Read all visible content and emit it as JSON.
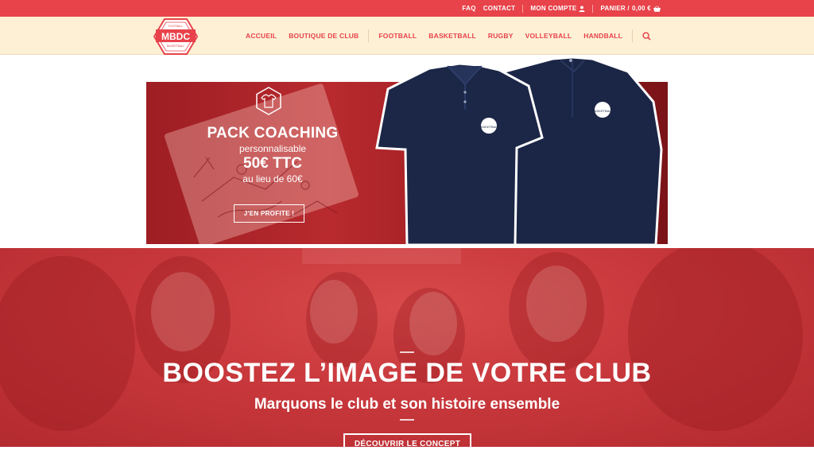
{
  "topbar": {
    "faq": "FAQ",
    "contact": "CONTACT",
    "account": "MON COMPTE",
    "cart": "PANIER /",
    "cart_total": "0,00 €"
  },
  "logo": {
    "text": "MBDC",
    "small_top": "FOOTBALL",
    "small_bottom": "BASKETBALL"
  },
  "nav": {
    "items": [
      {
        "label": "ACCUEIL"
      },
      {
        "label": "BOUTIQUE DE CLUB"
      },
      {
        "label": "FOOTBALL"
      },
      {
        "label": "BASKETBALL"
      },
      {
        "label": "RUGBY"
      },
      {
        "label": "VOLLEYBALL"
      },
      {
        "label": "HANDBALL"
      }
    ]
  },
  "promo": {
    "title": "PACK COACHING",
    "subtitle": "personnalisable",
    "price": "50€ TTC",
    "old_price": "au lieu de 60€",
    "button": "J'EN PROFITE !",
    "garment_logo": "BASKETBALL"
  },
  "hero": {
    "title": "BOOSTEZ L’IMAGE DE VOTRE CLUB",
    "subtitle": "Marquons le club et son histoire ensemble",
    "button": "DÉCOUVRIR LE CONCEPT"
  },
  "colors": {
    "brand_red": "#e8424a",
    "header_cream": "#fdf0d5",
    "navy": "#1c2747"
  }
}
